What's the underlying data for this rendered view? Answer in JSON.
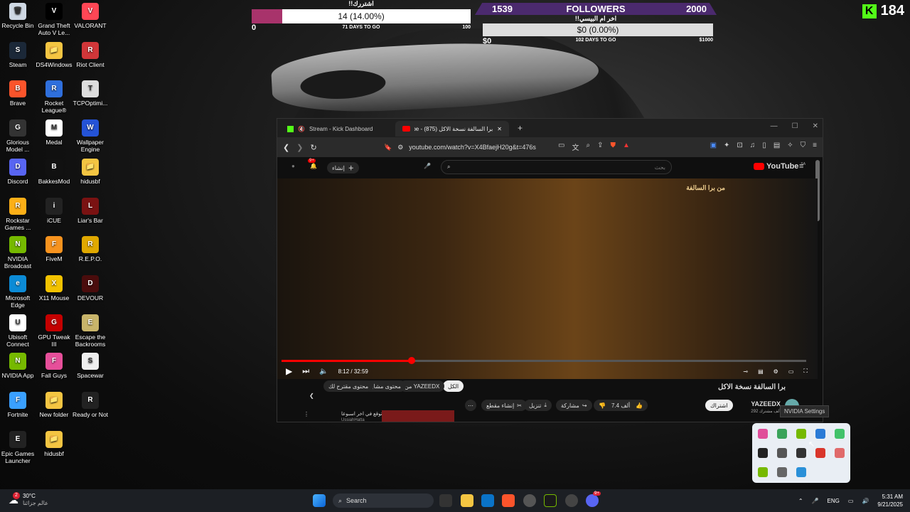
{
  "desktop_icons": [
    {
      "label": "Recycle Bin",
      "color": "#cfd8e3",
      "glyph": "🗑"
    },
    {
      "label": "Grand Theft Auto V Le...",
      "color": "#000",
      "glyph": "V"
    },
    {
      "label": "VALORANT",
      "color": "#ff4655",
      "glyph": "V"
    },
    {
      "label": "Steam",
      "color": "#1b2838",
      "glyph": "S"
    },
    {
      "label": "DS4Windows",
      "color": "#f4c542",
      "glyph": "📁"
    },
    {
      "label": "Riot Client",
      "color": "#d13639",
      "glyph": "R"
    },
    {
      "label": "Brave",
      "color": "#fb542b",
      "glyph": "B"
    },
    {
      "label": "Rocket League®",
      "color": "#2f6fdc",
      "glyph": "R"
    },
    {
      "label": "TCPOptimi...",
      "color": "#ddd",
      "glyph": "T"
    },
    {
      "label": "Glorious Model ...",
      "color": "#333",
      "glyph": "G"
    },
    {
      "label": "Medal",
      "color": "#fff",
      "glyph": "M"
    },
    {
      "label": "Wallpaper Engine",
      "color": "#2453d6",
      "glyph": "W"
    },
    {
      "label": "Discord",
      "color": "#5865f2",
      "glyph": "D"
    },
    {
      "label": "BakkesMod",
      "color": "#111",
      "glyph": "B"
    },
    {
      "label": "hidusbf",
      "color": "#f4c542",
      "glyph": "📁"
    },
    {
      "label": "Rockstar Games ...",
      "color": "#fcaf17",
      "glyph": "R"
    },
    {
      "label": "iCUE",
      "color": "#222",
      "glyph": "i"
    },
    {
      "label": "Liar's Bar",
      "color": "#7a1212",
      "glyph": "L"
    },
    {
      "label": "NVIDIA Broadcast",
      "color": "#76b900",
      "glyph": "N"
    },
    {
      "label": "FiveM",
      "color": "#f7931e",
      "glyph": "F"
    },
    {
      "label": "R.E.P.O.",
      "color": "#e0a800",
      "glyph": "R"
    },
    {
      "label": "Microsoft Edge",
      "color": "#0c8bd6",
      "glyph": "e"
    },
    {
      "label": "X11 Mouse",
      "color": "#f2c200",
      "glyph": "X"
    },
    {
      "label": "DEVOUR",
      "color": "#4a0c0c",
      "glyph": "D"
    },
    {
      "label": "Ubisoft Connect",
      "color": "#fff",
      "glyph": "U"
    },
    {
      "label": "GPU Tweak III",
      "color": "#c40000",
      "glyph": "G"
    },
    {
      "label": "Escape the Backrooms",
      "color": "#c8b46a",
      "glyph": "E"
    },
    {
      "label": "NVIDIA App",
      "color": "#76b900",
      "glyph": "N"
    },
    {
      "label": "Fall Guys",
      "color": "#e64f9a",
      "glyph": "F"
    },
    {
      "label": "Spacewar",
      "color": "#eee",
      "glyph": "S"
    },
    {
      "label": "Fortnite",
      "color": "#3aa0ff",
      "glyph": "F"
    },
    {
      "label": "New folder",
      "color": "#f4c542",
      "glyph": "📁"
    },
    {
      "label": "Ready or Not",
      "color": "#222",
      "glyph": "R"
    },
    {
      "label": "Epic Games Launcher",
      "color": "#222",
      "glyph": "E"
    },
    {
      "label": "hidusbf",
      "color": "#f4c542",
      "glyph": "📁"
    }
  ],
  "subs": {
    "title": "!!اشتررك",
    "value": "14 (14.00%)",
    "progress": 0.14,
    "min": "0",
    "days": "71 DAYS TO GO",
    "max": "100",
    "accent": "#a8336b"
  },
  "followers": {
    "current": "1539",
    "label": "FOLLOWERS",
    "goal": "2000",
    "donation_title": "!!اخر ام البيسي",
    "donation_value": "$0 (0.00%)",
    "min": "$0",
    "days": "102 DAYS TO GO",
    "max": "$1000"
  },
  "kick": {
    "logo": "K",
    "count": "184"
  },
  "browser": {
    "tab1": "Stream - Kick Dashboard",
    "tab2": "برا السالفة نسخة الاكل (875) - ube",
    "url": "youtube.com/watch?v=X4BfaejH20g&t=476s",
    "yt_logo": "YouTube",
    "yt_region": "SA",
    "search_placeholder": "بحث",
    "create_label": "إنشاء",
    "notif_count": "9+",
    "video_badge": "من برا السالفة",
    "time": "8:12 / 32:59",
    "progress": 0.248,
    "video_title": "برا السالفة نسخة الاكل",
    "channel": "YAZEEDX",
    "subscribers": "292 ألف مشترك",
    "subscribe": "اشتراك",
    "likes": "7.4 ألف",
    "share": "مشاركة",
    "download": "تنزيل",
    "clip": "إنشاء مقطع",
    "more": "⋯",
    "chips": [
      "الكل",
      "من YAZEEDX",
      "محتوى مشابه",
      "محتوى مقترح لك"
    ],
    "rec_title": "محمد توقع في اخر اسبوعا...",
    "rec_channel": "UssiahHatta"
  },
  "tray": {
    "tooltip": "NVIDIA Settings",
    "colors": [
      "#e04e9a",
      "#3aa35a",
      "#76b900",
      "#2b7bd6",
      "#42c26a",
      "#222",
      "#555",
      "#333",
      "#d9362b",
      "#e06a6a",
      "#76b900",
      "#666",
      "#2a90d8"
    ]
  },
  "taskbar": {
    "temp": "30°C",
    "weather": "عالم جزائنا",
    "weather_badge": "2",
    "search": "Search",
    "lang": "ENG",
    "time": "5:31 AM",
    "date": "9/21/2025",
    "discord_badge": "9+"
  }
}
